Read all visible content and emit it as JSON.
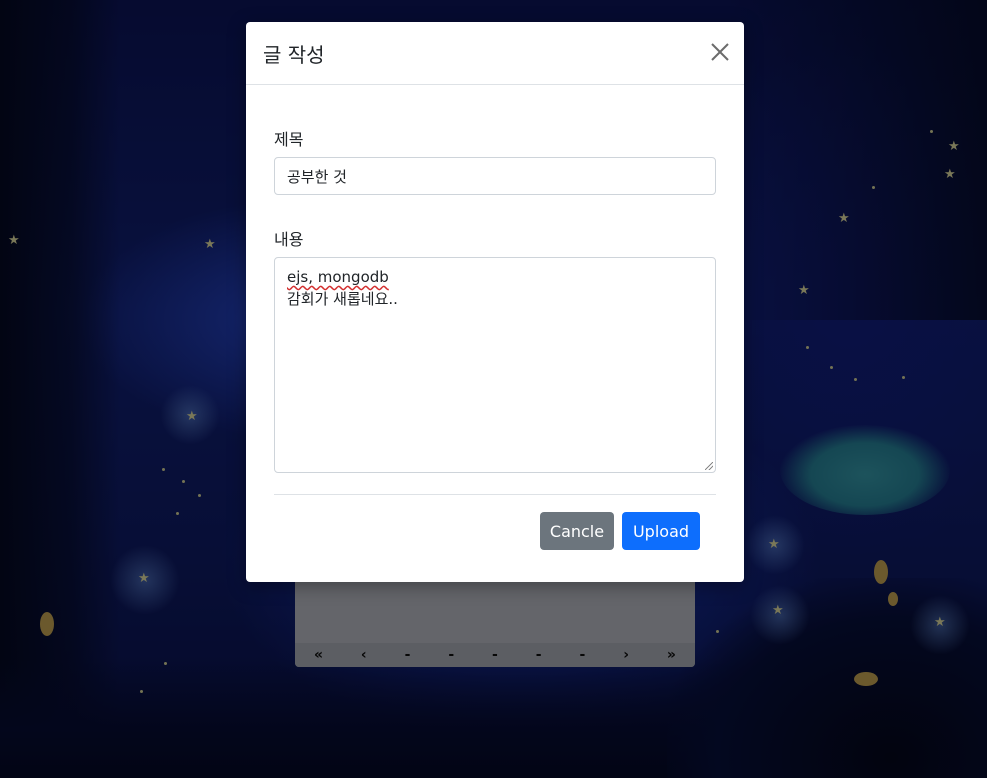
{
  "modal": {
    "title": "글 작성",
    "title_label": "제목",
    "title_value": "공부한 것",
    "content_label": "내용",
    "content_line1": "ejs, mongodb",
    "content_line2": "감회가 새롭네요..",
    "cancel_label": "Cancle",
    "upload_label": "Upload"
  },
  "pager": {
    "first": "«",
    "prev": "‹",
    "pages": [
      "-",
      "-",
      "-",
      "-",
      "-"
    ],
    "next": "›",
    "last": "»"
  },
  "colors": {
    "cancel_button": "#6c757d",
    "upload_button": "#0d6efd"
  },
  "icons": {
    "close": "close-icon"
  }
}
